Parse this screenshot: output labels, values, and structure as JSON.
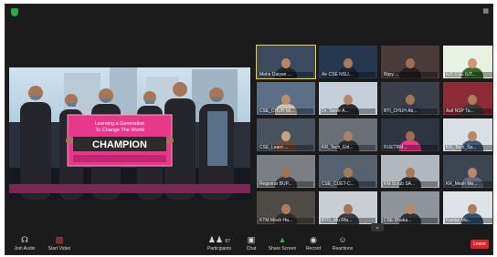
{
  "meeting": {
    "view_label": "▦",
    "stage": {
      "banner_line1": "Learning a Generation",
      "banner_line2": "To Change The World",
      "banner_main": "CHAMPION"
    }
  },
  "participants": [
    {
      "name": "Mahir Daiyan ...",
      "active": true
    },
    {
      "name": "Air CSE NSU...",
      "active": false
    },
    {
      "name": "Bijoy ...",
      "active": false
    },
    {
      "name": "IUT CSE IUT...",
      "active": false
    },
    {
      "name": "CSE_CHUH Mi...",
      "active": false
    },
    {
      "name": "Dr. Tanvir A...",
      "active": false
    },
    {
      "name": "BTI_CHUH Ab...",
      "active": false
    },
    {
      "name": "Asif NSP Ta...",
      "active": false
    },
    {
      "name": "CSE_Learn ...",
      "active": false
    },
    {
      "name": "KR_Tech_Eid...",
      "active": false
    },
    {
      "name": "RUETRM...",
      "active": false
    },
    {
      "name": "KR_Tech_Sa...",
      "active": false
    },
    {
      "name": "Registrar BUP...",
      "active": false
    },
    {
      "name": "CSE_CUET-C...",
      "active": false
    },
    {
      "name": "KM Scrub SA...",
      "active": false
    },
    {
      "name": "KR_Mesh Me...",
      "active": false
    },
    {
      "name": "KTM Mesh Ha...",
      "active": false
    },
    {
      "name": "BTO_Mu Rfa...",
      "active": false
    },
    {
      "name": "CSE Dhaka...",
      "active": false
    },
    {
      "name": "Kavian Mu...",
      "active": false
    }
  ],
  "toolbar": {
    "join_audio": "Join Audio",
    "start_video": "Start Video",
    "participants": "Participants",
    "participants_count": "67",
    "chat": "Chat",
    "share_screen": "Share Screen",
    "record": "Record",
    "reactions": "Reactions",
    "leave": "Leave",
    "icons": {
      "join_audio": "headphones-icon",
      "start_video": "video-off-icon",
      "participants": "participants-icon",
      "chat": "chat-icon",
      "share_screen": "share-screen-icon",
      "record": "record-icon",
      "reactions": "reactions-icon"
    }
  },
  "colors": {
    "background": "#1b1b1b",
    "active_speaker_border": "#f5d21e",
    "share_screen": "#2fb34a",
    "leave": "#d9242f",
    "banner": "#e8388c"
  }
}
